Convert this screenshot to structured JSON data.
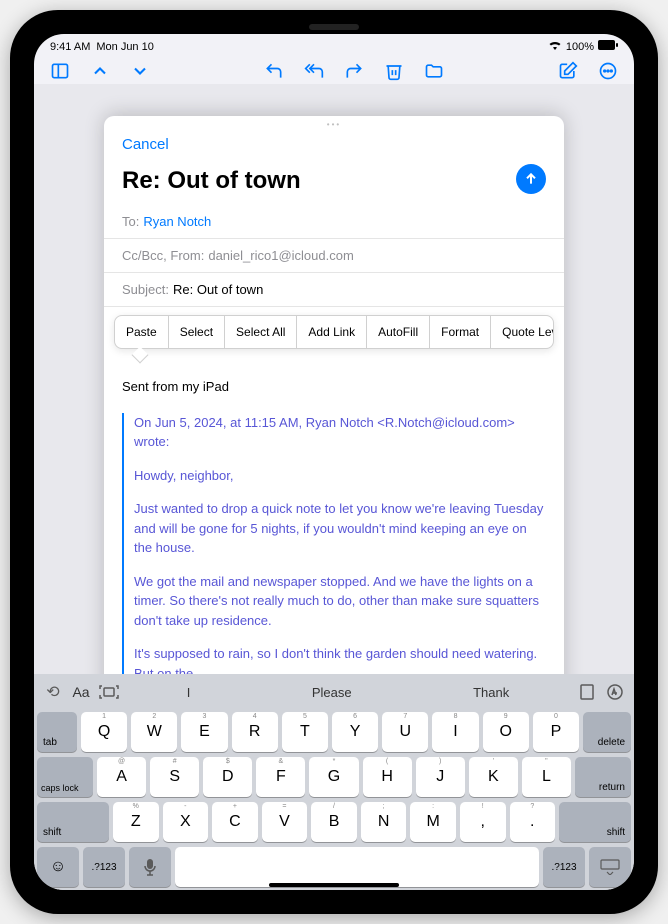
{
  "status": {
    "time": "9:41 AM",
    "date": "Mon Jun 10",
    "battery": "100%"
  },
  "compose": {
    "cancel": "Cancel",
    "title": "Re: Out of town",
    "to_label": "To:",
    "to_value": "Ryan Notch",
    "ccbcc_label": "Cc/Bcc, From:",
    "ccbcc_value": "daniel_rico1@icloud.com",
    "subject_label": "Subject:",
    "subject_value": "Re: Out of town"
  },
  "context_menu": {
    "items": [
      "Paste",
      "Select",
      "Select All",
      "Add Link",
      "AutoFill",
      "Format",
      "Quote Level"
    ]
  },
  "body": {
    "signature": "Sent from my iPad",
    "quote_header": "On Jun 5, 2024, at 11:15 AM, Ryan Notch <R.Notch@icloud.com> wrote:",
    "greeting": "Howdy, neighbor,",
    "p1": "Just wanted to drop a quick note to let you know we're leaving Tuesday and will be gone for 5 nights, if you wouldn't mind keeping an eye on the house.",
    "p2": "We got the mail and newspaper stopped. And we have the lights on a timer. So there's not really much to do, other than make sure squatters don't take up residence.",
    "p3": "It's supposed to rain, so I don't think the garden should need watering. But on the"
  },
  "keyboard": {
    "suggestions": [
      "I",
      "Please",
      "Thank"
    ],
    "row1": [
      "Q",
      "W",
      "E",
      "R",
      "T",
      "Y",
      "U",
      "I",
      "O",
      "P"
    ],
    "row1sub": [
      "1",
      "2",
      "3",
      "4",
      "5",
      "6",
      "7",
      "8",
      "9",
      "0"
    ],
    "row2": [
      "A",
      "S",
      "D",
      "F",
      "G",
      "H",
      "J",
      "K",
      "L"
    ],
    "row2sub": [
      "@",
      "#",
      "$",
      "&",
      "*",
      "(",
      ")",
      "'",
      "\""
    ],
    "row3": [
      "Z",
      "X",
      "C",
      "V",
      "B",
      "N",
      "M",
      ",",
      "."
    ],
    "row3sub": [
      "%",
      "-",
      "+",
      "=",
      "/",
      ";",
      ":",
      "!",
      "?"
    ],
    "tab": "tab",
    "delete": "delete",
    "caps": "caps lock",
    "return": "return",
    "shift": "shift",
    "numkey": ".?123"
  }
}
